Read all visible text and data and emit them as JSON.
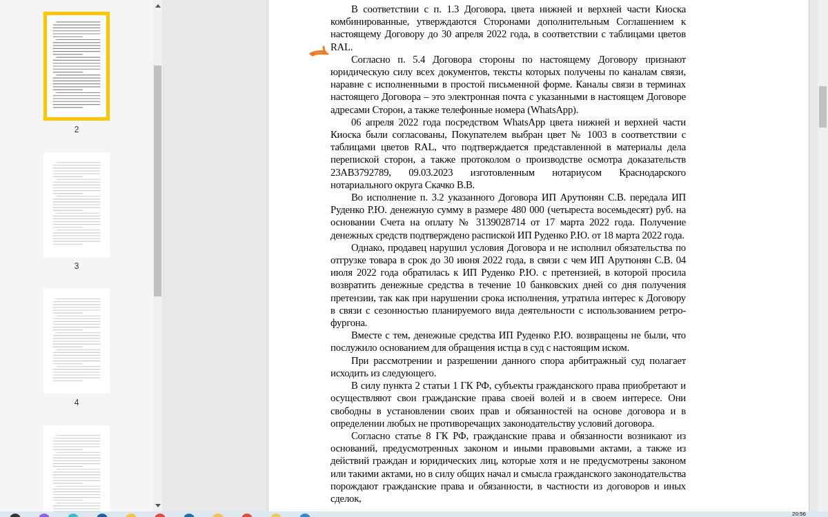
{
  "thumbnails": [
    {
      "label": "2",
      "selected": true
    },
    {
      "label": "3",
      "selected": false
    },
    {
      "label": "4",
      "selected": false
    },
    {
      "selected": false
    }
  ],
  "document": {
    "paragraphs": [
      "В соответствии с п. 1.3 Договора, цвета нижней и верхней части Киоска комбинированные, утверждаются Сторонами дополнительным Соглашением к настоящему Договору до 30 апреля 2022 года, в соответствии с таблицами цветов RAL.",
      "Согласно п. 5.4 Договора стороны по настоящему Договору признают юридическую силу всех документов, тексты которых получены по каналам связи, наравне с исполненными в простой письменной форме. Каналы связи в терминах настоящего Договора – это электронная почта с указанными в настоящем Договоре адресами Сторон, а также телефонные номера (WhatsApp).",
      "06 апреля 2022 года посредством WhatsApp цвета нижней и верхней части Киоска были согласованы, Покупателем выбран цвет № 1003 в соответствии с таблицами цветов RAL, что подтверждается представленной в материалы дела перепиской сторон, а также протоколом о производстве осмотра доказательств 23АВ3792789, 09.03.2023 изготовленным нотариусом Краснодарского нотариального округа Скачко В.В.",
      "Во исполнение п. 3.2 указанного Договора ИП Арутюнян С.В. передала ИП Руденко Р.Ю. денежную сумму в размере 480 000 (четыреста восемьдесят) руб. на основании Счета на оплату № 3139028714 от 17 марта 2022 года. Получение денежных средств подтверждено распиской ИП Руденко Р.Ю. от 18 марта 2022 года.",
      "Однако, продавец нарушил условия Договора и не исполнил обязательства по отгрузке товара в срок до 30 июня 2022 года, в связи с чем ИП Арутюнян С.В. 04 июля 2022 года обратилась к ИП Руденко Р.Ю. с претензией, в которой просила возвратить денежные средства в течение 10 банковских дней со дня получения претензии, так как при нарушении срока исполнения, утратила интерес к Договору в связи с сезонностью планируемого вида деятельности с использованием ретро-фургона.",
      "Вместе с тем, денежные средства ИП Руденко Р.Ю. возвращены не были, что послужило основанием для обращения истца в суд с настоящим иском.",
      "При рассмотрении и разрешении данного спора арбитражный суд полагает исходить из следующего.",
      "В силу пункта 2 статьи 1 ГК РФ, субъекты гражданского права приобретают и осуществляют свои гражданские права своей волей и в своем интересе. Они свободны в установлении своих прав и обязанностей на основе договора и в определении любых не противоречащих законодательству условий договора.",
      "Согласно статье 8 ГК РФ, гражданские права и обязанности возникают из оснований, предусмотренных законом и иными правовыми актами, а также из действий граждан и юридических лиц, которые хотя и не предусмотрены законом или такими актами, но в силу общих начал и смысла гражданского законодательства порождают гражданские права и обязанности, в частности из договоров и иных сделок,"
    ]
  },
  "taskbar": {
    "clock": "20:56"
  }
}
